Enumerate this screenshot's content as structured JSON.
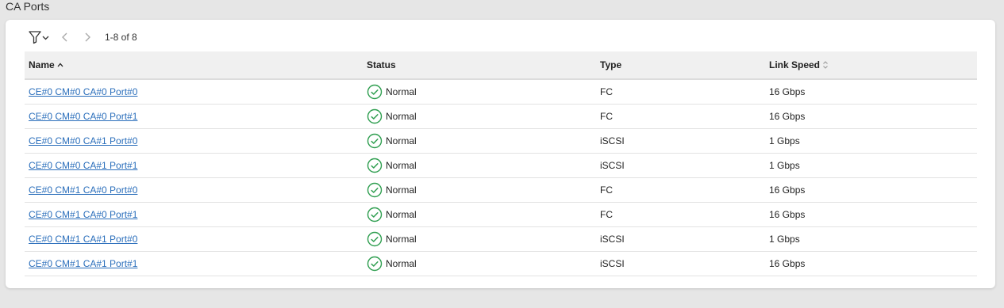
{
  "section_title": "CA Ports",
  "toolbar": {
    "filter_icon": "filter-icon",
    "prev_icon": "chevron-left-icon",
    "next_icon": "chevron-right-icon",
    "pager_text": "1-8 of 8"
  },
  "columns": {
    "name": "Name",
    "status": "Status",
    "type": "Type",
    "link_speed": "Link Speed"
  },
  "colors": {
    "link": "#2a6ebb",
    "status_ok": "#2e9e4f",
    "header_bg": "#f0f0f0"
  },
  "rows": [
    {
      "name": "CE#0 CM#0 CA#0 Port#0",
      "status": "Normal",
      "type": "FC",
      "speed": "16 Gbps"
    },
    {
      "name": "CE#0 CM#0 CA#0 Port#1",
      "status": "Normal",
      "type": "FC",
      "speed": "16 Gbps"
    },
    {
      "name": "CE#0 CM#0 CA#1 Port#0",
      "status": "Normal",
      "type": "iSCSI",
      "speed": "1 Gbps"
    },
    {
      "name": "CE#0 CM#0 CA#1 Port#1",
      "status": "Normal",
      "type": "iSCSI",
      "speed": "1 Gbps"
    },
    {
      "name": "CE#0 CM#1 CA#0 Port#0",
      "status": "Normal",
      "type": "FC",
      "speed": "16 Gbps"
    },
    {
      "name": "CE#0 CM#1 CA#0 Port#1",
      "status": "Normal",
      "type": "FC",
      "speed": "16 Gbps"
    },
    {
      "name": "CE#0 CM#1 CA#1 Port#0",
      "status": "Normal",
      "type": "iSCSI",
      "speed": "1 Gbps"
    },
    {
      "name": "CE#0 CM#1 CA#1 Port#1",
      "status": "Normal",
      "type": "iSCSI",
      "speed": "16 Gbps"
    }
  ]
}
